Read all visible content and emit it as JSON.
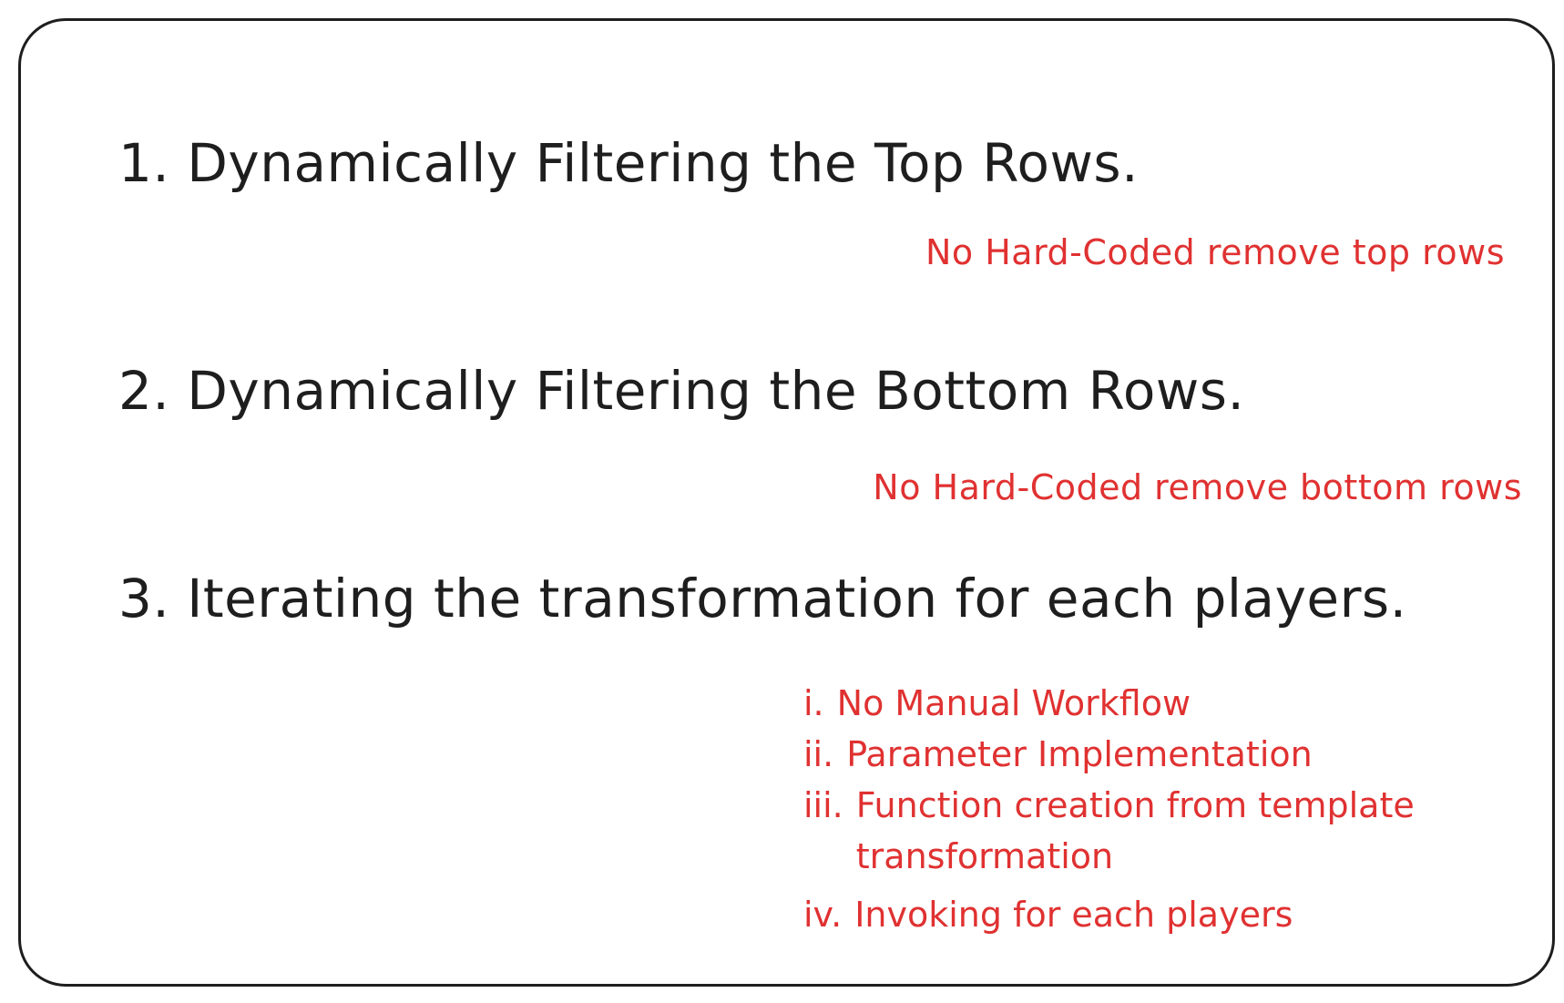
{
  "headings": [
    "1. Dynamically Filtering the Top Rows.",
    "2. Dynamically Filtering the Bottom Rows.",
    "3. Iterating the transformation for each players."
  ],
  "notes": {
    "top": "No Hard-Coded remove top rows",
    "bottom": "No Hard-Coded remove bottom rows"
  },
  "subitems": [
    {
      "marker": "i.",
      "text": "No Manual Workflow"
    },
    {
      "marker": "ii.",
      "text": "Parameter Implementation"
    },
    {
      "marker": "iii.",
      "text": "Function creation from template transformation"
    },
    {
      "marker": "iv.",
      "text": "Invoking for each players"
    }
  ],
  "colors": {
    "text": "#1e1e1e",
    "accent": "#e03131",
    "border": "#1e1e1e",
    "background": "#ffffff"
  }
}
